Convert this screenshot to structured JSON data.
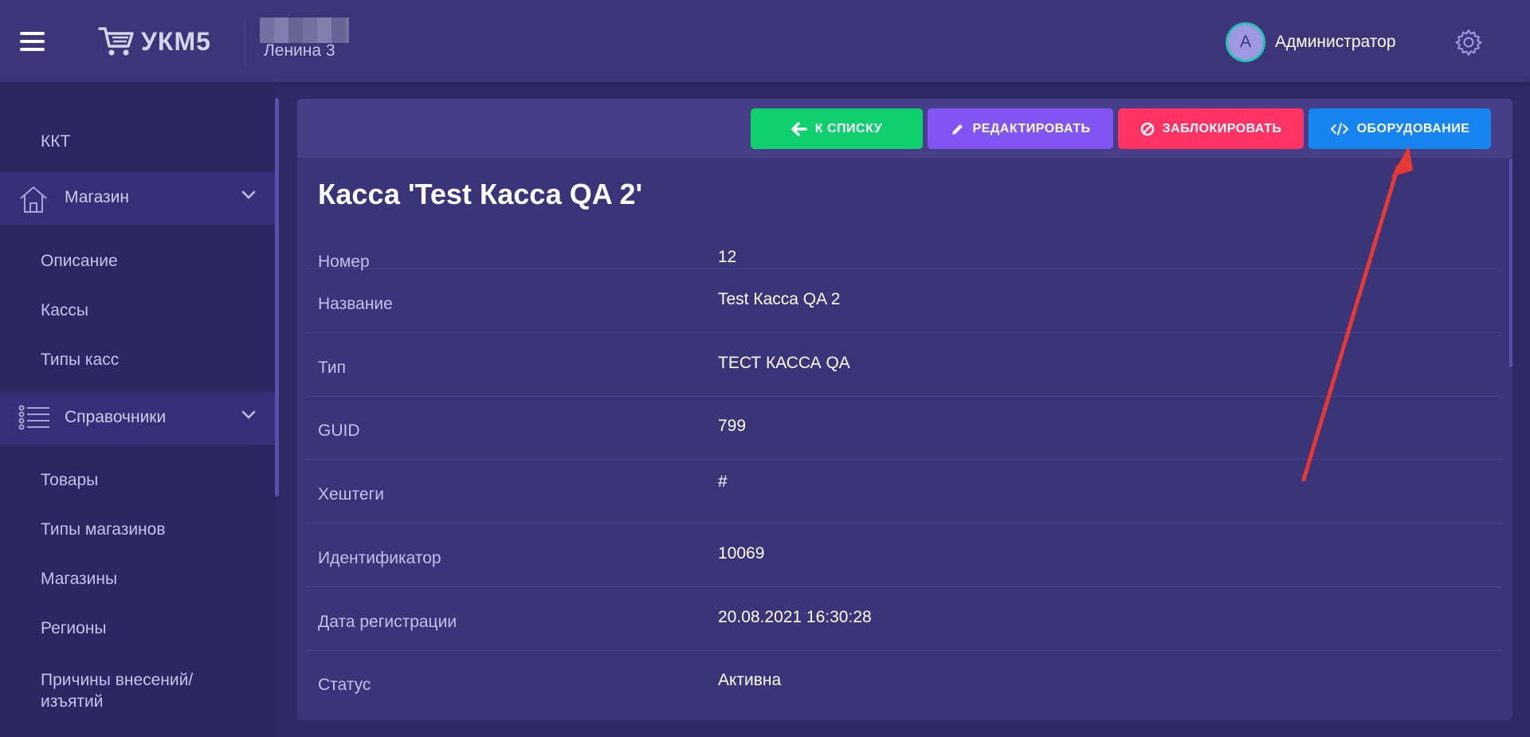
{
  "header": {
    "app_name": "УКМ5",
    "store_name": "Ленина 3",
    "user_initial": "А",
    "user_name": "Администратор"
  },
  "sidebar": {
    "top_item": "ККТ",
    "groups": [
      {
        "label": "Магазин",
        "icon": "home-icon",
        "items": [
          "Описание",
          "Кассы",
          "Типы касс"
        ]
      },
      {
        "label": "Справочники",
        "icon": "list-icon",
        "items": [
          "Товары",
          "Типы магазинов",
          "Магазины",
          "Регионы",
          "Причины внесений/\nизъятий"
        ]
      }
    ]
  },
  "toolbar": {
    "back_label": "К СПИСКУ",
    "edit_label": "РЕДАКТИРОВАТЬ",
    "block_label": "ЗАБЛОКИРОВАТЬ",
    "equipment_label": "ОБОРУДОВАНИЕ"
  },
  "details": {
    "title": "Касса 'Test Касса QA 2'",
    "rows": [
      {
        "label": "Номер",
        "value": "12"
      },
      {
        "label": "Название",
        "value": "Test Касса QA 2"
      },
      {
        "label": "Тип",
        "value": "ТЕСТ КАССА QA"
      },
      {
        "label": "GUID",
        "value": "799"
      },
      {
        "label": "Хештеги",
        "value": "#"
      },
      {
        "label": "Идентификатор",
        "value": "10069"
      },
      {
        "label": "Дата регистрации",
        "value": "20.08.2021 16:30:28"
      },
      {
        "label": "Статус",
        "value": "Активна"
      }
    ]
  },
  "colors": {
    "background": "#2f2966",
    "header": "#3c3578",
    "back_button": "#0fcf6e",
    "edit_button": "#8155f1",
    "block_button": "#ff3365",
    "equipment_button": "#1685f2",
    "annotation_arrow": "#e53935"
  }
}
